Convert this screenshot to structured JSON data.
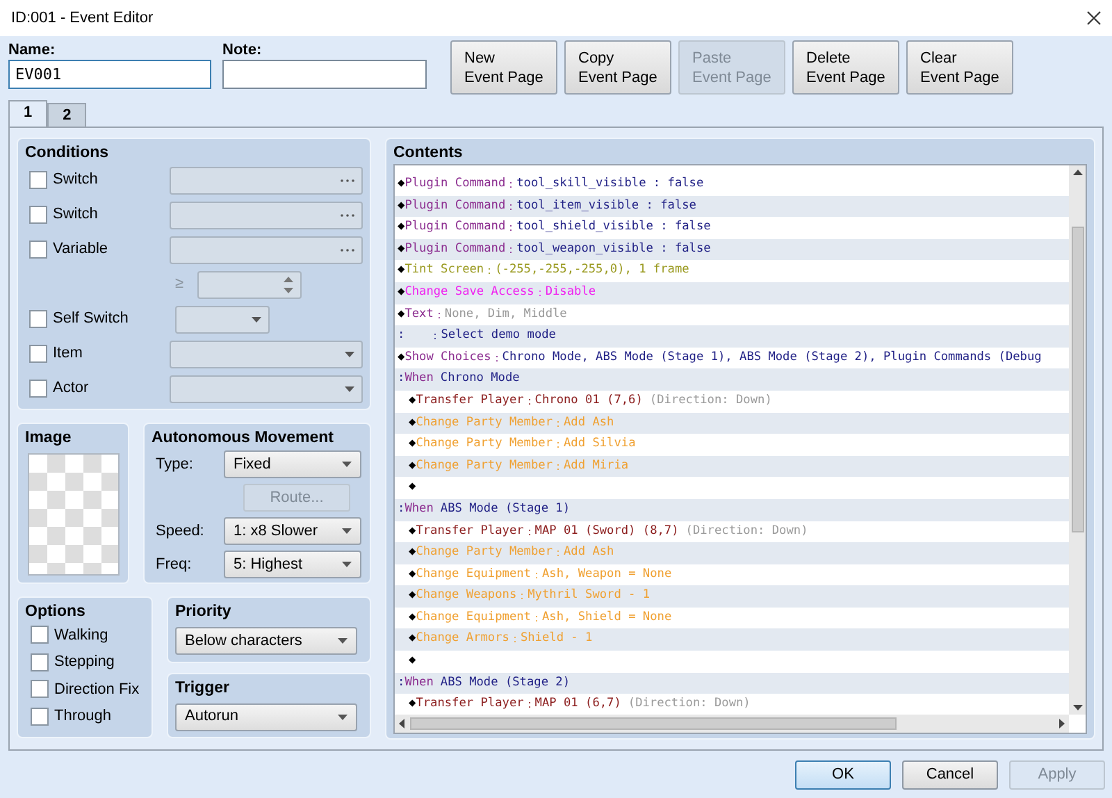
{
  "window": {
    "title": "ID:001 - Event Editor"
  },
  "name_field": {
    "label": "Name:",
    "value": "EV001"
  },
  "note_field": {
    "label": "Note:"
  },
  "page_buttons": [
    {
      "label": "New\nEvent Page",
      "disabled": false
    },
    {
      "label": "Copy\nEvent Page",
      "disabled": false
    },
    {
      "label": "Paste\nEvent Page",
      "disabled": true
    },
    {
      "label": "Delete\nEvent Page",
      "disabled": false
    },
    {
      "label": "Clear\nEvent Page",
      "disabled": false
    }
  ],
  "tabs": [
    {
      "label": "1",
      "selected": true
    },
    {
      "label": "2",
      "selected": false
    }
  ],
  "conditions": {
    "title": "Conditions",
    "items": [
      {
        "kind": "picker",
        "label": "Switch",
        "checked": false,
        "disabled": true
      },
      {
        "kind": "picker",
        "label": "Switch",
        "checked": false,
        "disabled": true
      },
      {
        "kind": "picker",
        "label": "Variable",
        "checked": false,
        "disabled": true
      },
      {
        "kind": "compare",
        "symbol": "≥",
        "disabled": true
      },
      {
        "kind": "short-select",
        "label": "Self Switch",
        "checked": false,
        "disabled": true
      },
      {
        "kind": "select",
        "label": "Item",
        "checked": false,
        "disabled": true
      },
      {
        "kind": "select",
        "label": "Actor",
        "checked": false,
        "disabled": true
      }
    ]
  },
  "image": {
    "title": "Image"
  },
  "movement": {
    "title": "Autonomous Movement",
    "type_label": "Type:",
    "type": "Fixed",
    "route_button": {
      "label": "Route...",
      "disabled": true
    },
    "speed_label": "Speed:",
    "speed": "1: x8 Slower",
    "freq_label": "Freq:",
    "freq": "5: Highest"
  },
  "options": {
    "title": "Options",
    "items": [
      {
        "label": "Walking",
        "checked": false
      },
      {
        "label": "Stepping",
        "checked": false
      },
      {
        "label": "Direction Fix",
        "checked": false
      },
      {
        "label": "Through",
        "checked": false
      }
    ]
  },
  "priority": {
    "title": "Priority",
    "value": "Below characters"
  },
  "trigger": {
    "title": "Trigger",
    "value": "Autorun"
  },
  "contents": {
    "title": "Contents",
    "lines": [
      {
        "kind": "plugin",
        "marker": "◆",
        "name": "Plugin Command",
        "sep": "：",
        "args": "tool_skill_visible : false"
      },
      {
        "kind": "plugin",
        "marker": "◆",
        "name": "Plugin Command",
        "sep": "：",
        "args": "tool_item_visible : false"
      },
      {
        "kind": "plugin",
        "marker": "◆",
        "name": "Plugin Command",
        "sep": "：",
        "args": "tool_shield_visible : false"
      },
      {
        "kind": "plugin",
        "marker": "◆",
        "name": "Plugin Command",
        "sep": "：",
        "args": "tool_weapon_visible : false"
      },
      {
        "kind": "screen",
        "marker": "◆",
        "name": "Tint Screen",
        "sep": "：",
        "args": "(-255,-255,-255,0), 1 frame"
      },
      {
        "kind": "system",
        "marker": "◆",
        "name": "Change Save Access",
        "sep": "：",
        "args": "Disable"
      },
      {
        "kind": "text",
        "marker": "◆",
        "name": "Text",
        "sep": "：",
        "args": "None, Dim, Middle"
      },
      {
        "kind": "continuation",
        "marker": ":",
        "sep": "：",
        "args": "Select demo mode"
      },
      {
        "kind": "choices",
        "marker": "◆",
        "name": "Show Choices",
        "sep": "：",
        "args": "Chrono Mode, ABS Mode (Stage 1), ABS Mode (Stage 2), Plugin Commands (Debug"
      },
      {
        "kind": "branch",
        "marker": ":",
        "name": "When",
        "args": "Chrono Mode",
        "children": [
          {
            "kind": "transfer",
            "marker": "◆",
            "name": "Transfer Player",
            "sep": "：",
            "args": "Chrono 01 (7,6)",
            "note": "(Direction: Down)"
          },
          {
            "kind": "party",
            "marker": "◆",
            "name": "Change Party Member",
            "sep": "：",
            "args": "Add Ash"
          },
          {
            "kind": "party",
            "marker": "◆",
            "name": "Change Party Member",
            "sep": "：",
            "args": "Add Silvia"
          },
          {
            "kind": "party",
            "marker": "◆",
            "name": "Change Party Member",
            "sep": "：",
            "args": "Add Miria"
          },
          {
            "kind": "empty",
            "marker": "◆"
          }
        ]
      },
      {
        "kind": "branch",
        "marker": ":",
        "name": "When",
        "args": "ABS Mode (Stage 1)",
        "children": [
          {
            "kind": "transfer",
            "marker": "◆",
            "name": "Transfer Player",
            "sep": "：",
            "args": "MAP 01 (Sword) (8,7)",
            "note": "(Direction: Down)"
          },
          {
            "kind": "party",
            "marker": "◆",
            "name": "Change Party Member",
            "sep": "：",
            "args": "Add Ash"
          },
          {
            "kind": "party",
            "marker": "◆",
            "name": "Change Equipment",
            "sep": "：",
            "args": "Ash, Weapon = None"
          },
          {
            "kind": "party",
            "marker": "◆",
            "name": "Change Weapons",
            "sep": "：",
            "args": "Mythril Sword - 1"
          },
          {
            "kind": "party",
            "marker": "◆",
            "name": "Change Equipment",
            "sep": "：",
            "args": "Ash, Shield = None"
          },
          {
            "kind": "party",
            "marker": "◆",
            "name": "Change Armors",
            "sep": "：",
            "args": "Shield - 1"
          },
          {
            "kind": "empty",
            "marker": "◆"
          }
        ]
      },
      {
        "kind": "branch",
        "marker": ":",
        "name": "When",
        "args": "ABS Mode (Stage 2)",
        "children": [
          {
            "kind": "transfer",
            "marker": "◆",
            "name": "Transfer Player",
            "sep": "：",
            "args": "MAP 01 (6,7)",
            "note": "(Direction: Down)"
          }
        ]
      }
    ]
  },
  "dialog_buttons": [
    {
      "label": "OK",
      "default": true,
      "disabled": false
    },
    {
      "label": "Cancel",
      "default": false,
      "disabled": false
    },
    {
      "label": "Apply",
      "default": false,
      "disabled": true
    }
  ]
}
